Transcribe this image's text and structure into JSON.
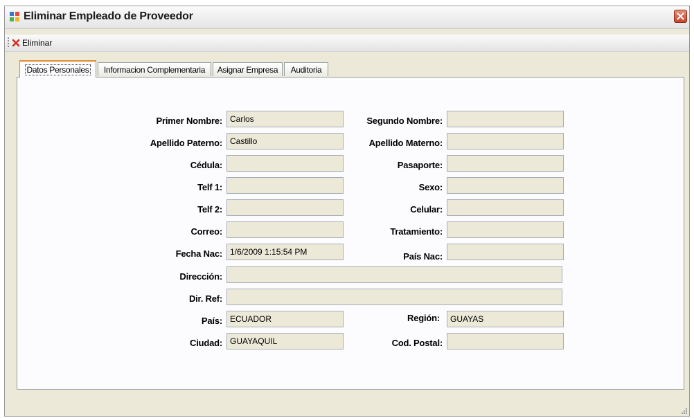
{
  "window": {
    "title": "Eliminar Empleado de Proveedor"
  },
  "toolbar": {
    "eliminar_label": "Eliminar"
  },
  "tabs": [
    {
      "label": "Datos Personales",
      "active": true
    },
    {
      "label": "Informacion Complementaria",
      "active": false
    },
    {
      "label": "Asignar Empresa",
      "active": false
    },
    {
      "label": "Auditoria",
      "active": false
    }
  ],
  "form": {
    "primer_nombre": {
      "label": "Primer Nombre:",
      "value": "Carlos"
    },
    "segundo_nombre": {
      "label": "Segundo Nombre:",
      "value": ""
    },
    "apellido_paterno": {
      "label": "Apellido Paterno:",
      "value": "Castillo"
    },
    "apellido_materno": {
      "label": "Apellido Materno:",
      "value": ""
    },
    "cedula": {
      "label": "Cédula:",
      "value": ""
    },
    "pasaporte": {
      "label": "Pasaporte:",
      "value": ""
    },
    "telf1": {
      "label": "Telf 1:",
      "value": ""
    },
    "sexo": {
      "label": "Sexo:",
      "value": ""
    },
    "telf2": {
      "label": "Telf 2:",
      "value": ""
    },
    "celular": {
      "label": "Celular:",
      "value": ""
    },
    "correo": {
      "label": "Correo:",
      "value": ""
    },
    "tratamiento": {
      "label": "Tratamiento:",
      "value": ""
    },
    "fecha_nac": {
      "label": "Fecha Nac:",
      "value": "1/6/2009 1:15:54 PM"
    },
    "pais_nac": {
      "label": "País Nac:",
      "value": ""
    },
    "direccion": {
      "label": "Dirección:",
      "value": ""
    },
    "dir_ref": {
      "label": "Dir. Ref:",
      "value": ""
    },
    "pais": {
      "label": "País:",
      "value": "ECUADOR"
    },
    "region": {
      "label": "Región:",
      "value": "GUAYAS"
    },
    "ciudad": {
      "label": "Ciudad:",
      "value": "GUAYAQUIL"
    },
    "cod_postal": {
      "label": "Cod. Postal:",
      "value": ""
    }
  },
  "icons": {
    "app": "window-app-icon",
    "close": "close-icon",
    "delete": "red-x-delete-icon",
    "grip": "toolbar-grip-icon",
    "resize": "resize-grip-icon"
  },
  "colors": {
    "window_bg": "#ece9d8",
    "panel_bg": "#fcfcfe",
    "active_tab_accent": "#e68b2c",
    "close_button": "#c5462b",
    "delete_icon": "#d42a1f"
  }
}
